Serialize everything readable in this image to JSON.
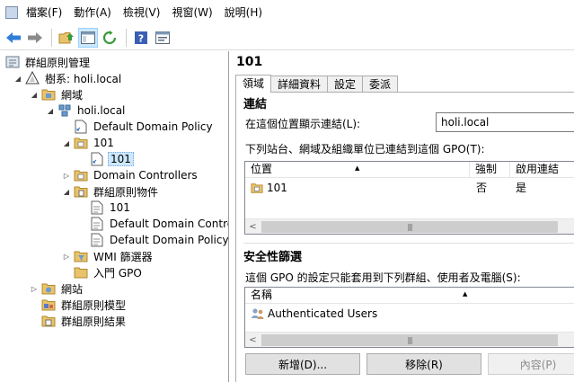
{
  "menu": {
    "items": [
      "檔案(F)",
      "動作(A)",
      "檢視(V)",
      "視窗(W)",
      "說明(H)"
    ]
  },
  "toolbar": {
    "buttons": [
      "back-arrow-icon",
      "forward-arrow-icon",
      "folder-up-icon",
      "show-hide-tree-icon",
      "refresh-icon",
      "help-icon",
      "properties-icon"
    ]
  },
  "tree": {
    "root": "群組原則管理",
    "forest": "樹系: holi.local",
    "domains": "網域",
    "domain": "holi.local",
    "default_policy": "Default Domain Policy",
    "ou_101": "101",
    "ou_101_link": "101",
    "domain_controllers": "Domain Controllers",
    "gpo_container": "群組原則物件",
    "gpo_101": "101",
    "gpo_ddc": "Default Domain Contro",
    "gpo_ddp": "Default Domain Policy",
    "wmi_filters": "WMI 篩選器",
    "starter_gpo": "入門 GPO",
    "sites": "網站",
    "modeling": "群組原則模型",
    "results": "群組原則結果"
  },
  "details": {
    "title": "101",
    "tabs": [
      "領域",
      "詳細資料",
      "設定",
      "委派"
    ],
    "links_section": {
      "title": "連結",
      "location_label": "在這個位置顯示連結(L):",
      "location_value": "holi.local",
      "desc": "下列站台、網域及組織單位已連結到這個 GPO(T):",
      "columns": [
        "位置",
        "強制",
        "啟用連結"
      ],
      "rows": [
        {
          "location": "101",
          "enforced": "否",
          "enabled": "是"
        }
      ]
    },
    "security_section": {
      "title": "安全性篩選",
      "desc": "這個 GPO 的設定只能套用到下列群組、使用者及電腦(S):",
      "columns": [
        "名稱"
      ],
      "rows": [
        {
          "name": "Authenticated Users"
        }
      ]
    },
    "buttons": {
      "add": "新增(D)...",
      "remove": "移除(R)",
      "properties": "內容(P)"
    }
  },
  "colors": {
    "selection": "#cce8ff",
    "folder": "#e8c36b",
    "nav_arrow": "#2f7ed8"
  }
}
